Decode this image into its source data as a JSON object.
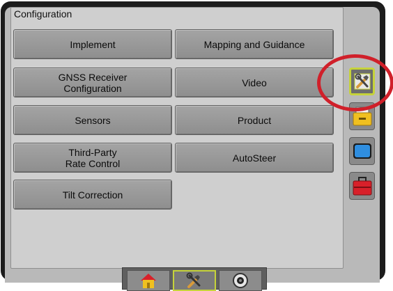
{
  "panel": {
    "title": "Configuration"
  },
  "buttons": {
    "implement": "Implement",
    "mapping_guidance": "Mapping and Guidance",
    "gnss_receiver": "GNSS Receiver\nConfiguration",
    "video": "Video",
    "sensors": "Sensors",
    "product": "Product",
    "third_party_rate": "Third-Party\nRate Control",
    "autosteer": "AutoSteer",
    "tilt_correction": "Tilt Correction"
  },
  "sidebar": {
    "tabs": [
      {
        "icon": "tools-icon",
        "selected": true
      },
      {
        "icon": "folder-icon",
        "selected": false
      },
      {
        "icon": "screen-icon",
        "selected": false
      },
      {
        "icon": "toolbox-icon",
        "selected": false
      }
    ]
  },
  "bottom_nav": {
    "tabs": [
      {
        "icon": "home-icon",
        "selected": false
      },
      {
        "icon": "tools-icon",
        "selected": true
      },
      {
        "icon": "gauge-icon",
        "selected": false
      }
    ]
  },
  "colors": {
    "selected_border": "#c6d33a",
    "highlight_circle": "#d0202a",
    "button_face": "#9a9a9a"
  }
}
